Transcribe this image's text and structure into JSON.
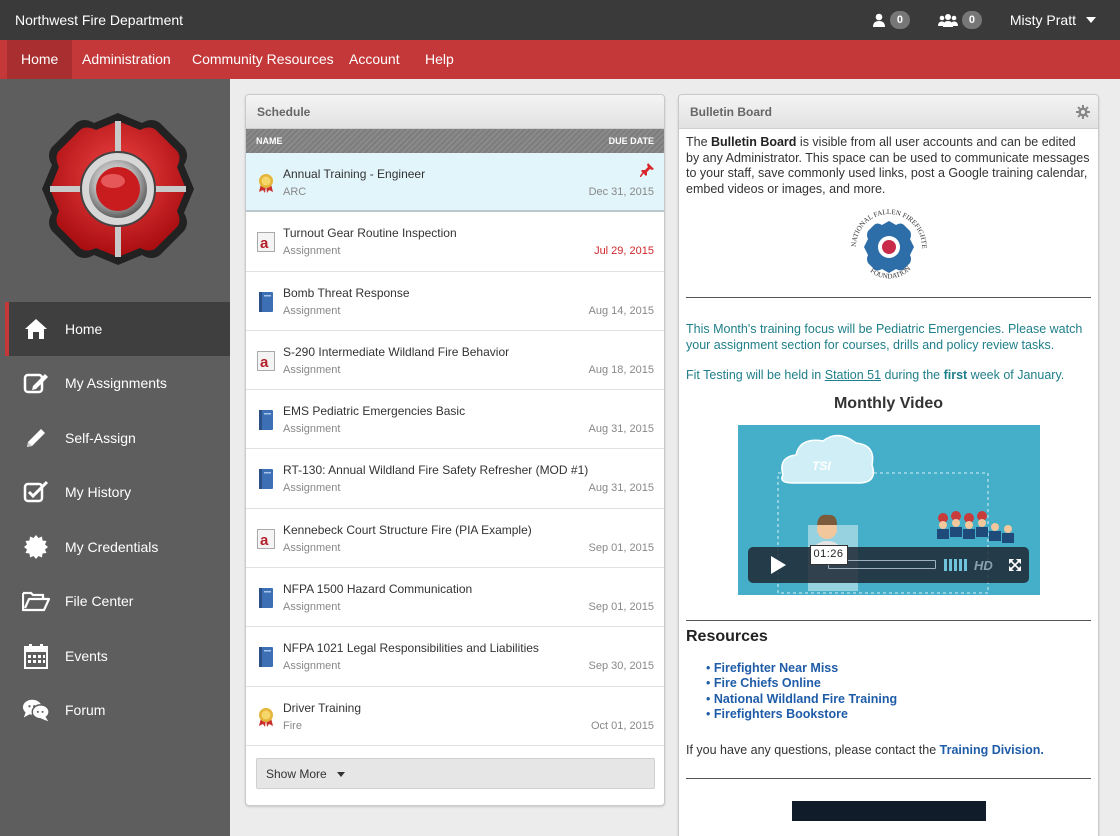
{
  "app": {
    "title": "Northwest Fire Department",
    "user_name": "Misty Pratt",
    "single_notif_count": "0",
    "group_notif_count": "0"
  },
  "nav": [
    "Home",
    "Administration",
    "Community Resources",
    "Account",
    "Help"
  ],
  "sidebar": {
    "items": [
      {
        "label": "Home",
        "icon": "home-icon"
      },
      {
        "label": "My Assignments",
        "icon": "edit-icon"
      },
      {
        "label": "Self-Assign",
        "icon": "pencil-icon"
      },
      {
        "label": "My History",
        "icon": "checkbox-icon"
      },
      {
        "label": "My Credentials",
        "icon": "badge-icon"
      },
      {
        "label": "File Center",
        "icon": "folder-open-icon"
      },
      {
        "label": "Events",
        "icon": "calendar-icon"
      },
      {
        "label": "Forum",
        "icon": "chat-icon"
      }
    ]
  },
  "schedule": {
    "title": "Schedule",
    "col_name": "NAME",
    "col_due": "DUE DATE",
    "rows": [
      {
        "title": "Annual Training - Engineer",
        "type": "ARC",
        "date": "Dec 31, 2015",
        "icon": "award-icon"
      },
      {
        "title": "Turnout Gear Routine Inspection",
        "type": "Assignment",
        "date": "Jul 29, 2015",
        "icon": "assignment-a-icon"
      },
      {
        "title": "Bomb Threat Response",
        "type": "Assignment",
        "date": "Aug 14, 2015",
        "icon": "book-icon"
      },
      {
        "title": "S-290 Intermediate Wildland Fire Behavior",
        "type": "Assignment",
        "date": "Aug 18, 2015",
        "icon": "assignment-a-icon"
      },
      {
        "title": "EMS Pediatric Emergencies Basic",
        "type": "Assignment",
        "date": "Aug 31, 2015",
        "icon": "book-icon"
      },
      {
        "title": "RT-130: Annual Wildland Fire Safety Refresher (MOD #1)",
        "type": "Assignment",
        "date": "Aug 31, 2015",
        "icon": "book-icon"
      },
      {
        "title": "Kennebeck Court Structure Fire (PIA Example)",
        "type": "Assignment",
        "date": "Sep 01, 2015",
        "icon": "assignment-a-icon"
      },
      {
        "title": "NFPA 1500 Hazard Communication",
        "type": "Assignment",
        "date": "Sep 01, 2015",
        "icon": "book-icon"
      },
      {
        "title": "NFPA 1021 Legal Responsibilities and Liabilities",
        "type": "Assignment",
        "date": "Sep 30, 2015",
        "icon": "book-icon"
      },
      {
        "title": "Driver Training",
        "type": "Fire",
        "date": "Oct 01, 2015",
        "icon": "award-icon"
      }
    ],
    "show_more": "Show More"
  },
  "bulletin": {
    "title": "Bulletin Board",
    "intro_pre": "The ",
    "intro_bold": "Bulletin Board",
    "intro_post": " is visible from all user accounts and can be edited by any Administrator. This space can be used to communicate messages to your staff, save commonly used links, post a Google training calendar, embed videos or images, and more.",
    "nfff_line1": "NATIONAL FALLEN FIREFIGHTERS",
    "nfff_line2": "FOUNDATION",
    "focus_text": "This Month's training focus will be Pediatric Emergencies. Please watch your assignment section for courses, drills and policy review tasks.",
    "fit_pre": "Fit Testing will be held in ",
    "fit_link": "Station 51",
    "fit_mid": " during the ",
    "fit_bold": "first",
    "fit_post": " week of January.",
    "video_heading": "Monthly Video",
    "video_time": "01:26",
    "video_logo": "TSI",
    "resources_heading": "Resources",
    "resources": [
      "Firefighter Near Miss",
      "Fire Chiefs Online",
      "National Wildland Fire Training",
      "Firefighters Bookstore"
    ],
    "contact_pre": "If you have any questions, please contact the ",
    "contact_link": "Training Division."
  }
}
